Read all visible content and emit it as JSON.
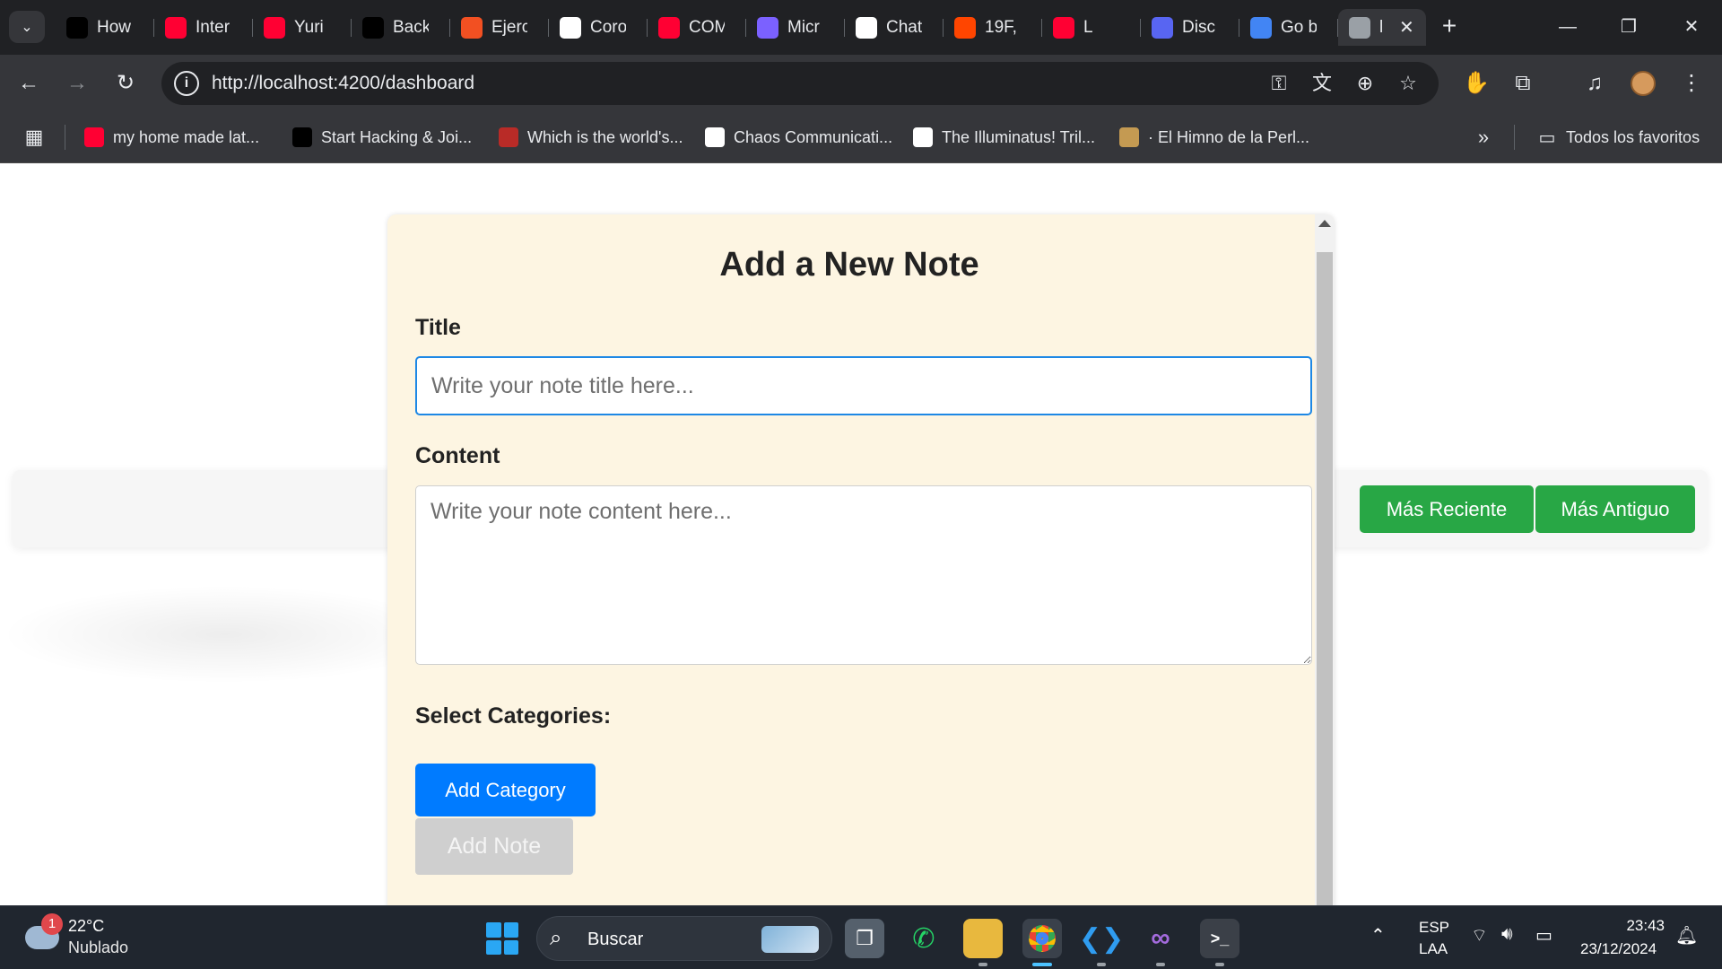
{
  "browser": {
    "tabs": [
      {
        "label": "How",
        "icon": "bold-b-icon",
        "color": "#000000"
      },
      {
        "label": "Inter",
        "icon": "youtube-icon",
        "color": "#ff0033"
      },
      {
        "label": "Yuri",
        "icon": "youtube-icon",
        "color": "#ff0033"
      },
      {
        "label": "Back",
        "icon": "r-logo-icon",
        "color": "#000000"
      },
      {
        "label": "Ejerc",
        "icon": "microsoft-logo-icon",
        "color": "#f25022"
      },
      {
        "label": "Coro",
        "icon": "github-icon",
        "color": "#ffffff"
      },
      {
        "label": "COM",
        "icon": "youtube-icon",
        "color": "#ff0033"
      },
      {
        "label": "Micr",
        "icon": "copilot-icon",
        "color": "#7b61ff"
      },
      {
        "label": "Chat",
        "icon": "chatgpt-icon",
        "color": "#ffffff"
      },
      {
        "label": "19F,",
        "icon": "reddit-icon",
        "color": "#ff4500"
      },
      {
        "label": "L",
        "icon": "youtube-icon",
        "color": "#ff0033"
      },
      {
        "label": "Disc",
        "icon": "discord-icon",
        "color": "#5865f2"
      },
      {
        "label": "Go b",
        "icon": "docs-icon",
        "color": "#4285f4"
      },
      {
        "label": "l",
        "icon": "globe-icon",
        "color": "#9aa0a6"
      }
    ],
    "url": "http://localhost:4200/dashboard",
    "bookmarks": [
      {
        "label": "my home made lat...",
        "icon": "youtube-icon",
        "color": "#ff0033"
      },
      {
        "label": "Start Hacking & Joi...",
        "icon": "hackerone-icon",
        "color": "#000000"
      },
      {
        "label": "Which is the world's...",
        "icon": "quora-icon",
        "color": "#b92b27"
      },
      {
        "label": "Chaos Communicati...",
        "icon": "wikipedia-icon",
        "color": "#ffffff"
      },
      {
        "label": "The Illuminatus! Tril...",
        "icon": "wikipedia-icon",
        "color": "#ffffff"
      },
      {
        "label": "· El Himno de la Perl...",
        "icon": "mosaic-icon",
        "color": "#c49a52"
      }
    ],
    "all_bookmarks": "Todos los favoritos"
  },
  "page": {
    "sort_buttons": {
      "recent": "Más Reciente",
      "oldest": "Más Antiguo"
    },
    "modal": {
      "heading": "Add a New Note",
      "title_label": "Title",
      "title_placeholder": "Write your note title here...",
      "content_label": "Content",
      "content_placeholder": "Write your note content here...",
      "categories_label": "Select Categories:",
      "add_category": "Add Category",
      "add_note": "Add Note"
    },
    "colors": {
      "modal_bg": "#fdf5e2",
      "primary": "#007bff",
      "success": "#28a745",
      "disabled": "#cfcfcf"
    }
  },
  "taskbar": {
    "weather": {
      "temp": "22°C",
      "desc": "Nublado",
      "badge": "1"
    },
    "search": "Buscar",
    "lang_top": "ESP",
    "lang_bottom": "LAA",
    "time": "23:43",
    "date": "23/12/2024"
  }
}
